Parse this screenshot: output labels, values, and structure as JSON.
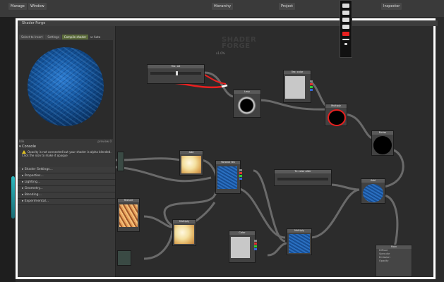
{
  "topbar": {
    "items": [
      "Manage",
      "Window",
      "Hierarchy",
      "Project",
      "Inspector"
    ]
  },
  "window": {
    "title": "Shader Forge"
  },
  "sidebar": {
    "tabs": [
      "Select to Insert",
      "Settings",
      "Compile shader"
    ],
    "auto_label": "Auto",
    "mesh_label": "sf_sphere",
    "rotate_label": "Rotate",
    "preview_status_left": "Idle",
    "preview_status_right": "preview 0",
    "console_label": "Console",
    "console_message": "Opacity is not connected but your shader is alpha blended. Click the icon to make it opaque",
    "sections": [
      "Shader Settings...",
      "Properties...",
      "Lighting...",
      "Geometry...",
      "Blending...",
      "Experimental..."
    ]
  },
  "canvas": {
    "logo_line1": "SHADER",
    "logo_line2": "FORGE",
    "zoom": "x1.0%"
  },
  "nodes": [
    {
      "id": "n1",
      "title": "Tex: alt"
    },
    {
      "id": "n2",
      "title": "Lerp"
    },
    {
      "id": "n3",
      "title": "Tex: color"
    },
    {
      "id": "n4",
      "title": "Multiply"
    },
    {
      "id": "n5",
      "title": "Emiss"
    },
    {
      "id": "n6",
      "title": "Add"
    },
    {
      "id": "n7",
      "title": "Voronoi tex"
    },
    {
      "id": "n8",
      "title": "Tx color alter"
    },
    {
      "id": "n9",
      "title": "Add"
    },
    {
      "id": "n10",
      "title": "Texture"
    },
    {
      "id": "n11",
      "title": "Multiply"
    },
    {
      "id": "n12",
      "title": "Color"
    },
    {
      "id": "n13",
      "title": "Multiply"
    },
    {
      "id": "n14",
      "title": "Main"
    }
  ],
  "main_panel": {
    "title": "Main",
    "inputs": [
      "Diffuse",
      "Specular",
      "Emission",
      "Opacity"
    ]
  },
  "colors": {
    "accent_red": "#e82020",
    "window_border": "#ffffff",
    "cyan_glow": "#2fe0e8"
  }
}
